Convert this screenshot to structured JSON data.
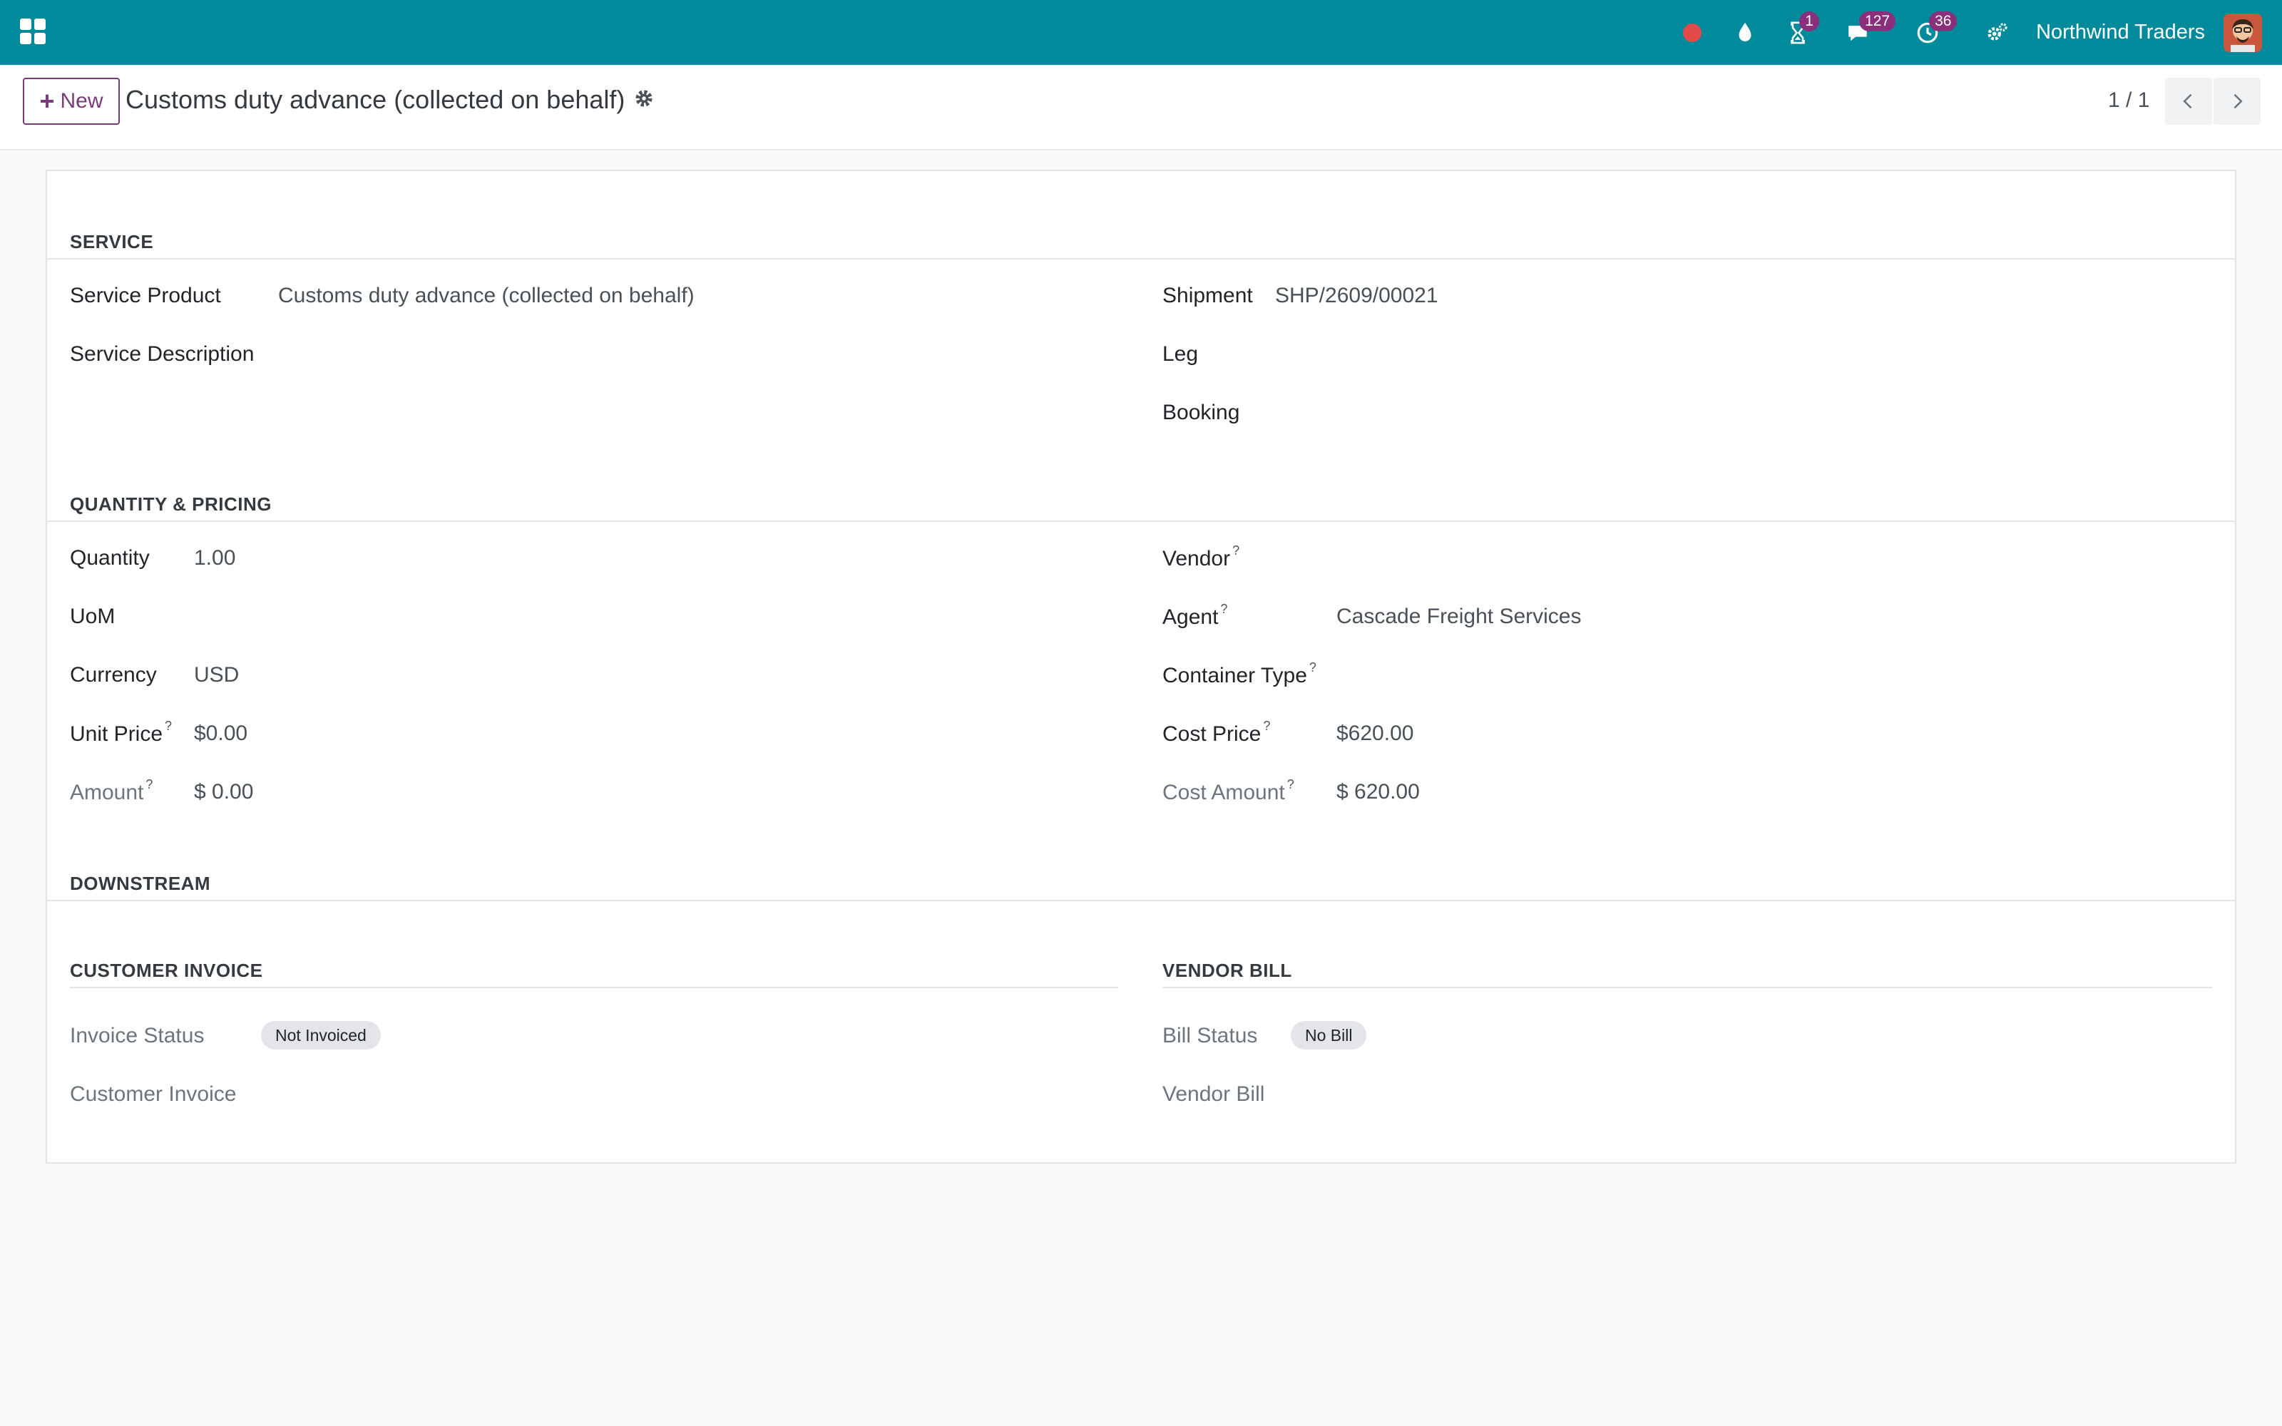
{
  "navbar": {
    "company": "Northwind Traders",
    "activity_count": "1",
    "messages_count": "127",
    "clock_count": "36",
    "accent": "#008a9c"
  },
  "control": {
    "new_label": "New",
    "title": "Customs duty advance (collected on behalf)",
    "pager": "1 / 1"
  },
  "service": {
    "section_title": "SERVICE",
    "product_label": "Service Product",
    "product_value": "Customs duty advance (collected on behalf)",
    "description_label": "Service Description",
    "shipment_label": "Shipment",
    "shipment_value": "SHP/2609/00021",
    "leg_label": "Leg",
    "booking_label": "Booking"
  },
  "pricing": {
    "section_title": "QUANTITY & PRICING",
    "quantity_label": "Quantity",
    "quantity_value": "1.00",
    "uom_label": "UoM",
    "currency_label": "Currency",
    "currency_value": "USD",
    "unit_price_label": "Unit Price",
    "unit_price_value": "$0.00",
    "amount_label": "Amount",
    "amount_value": "$ 0.00",
    "vendor_label": "Vendor",
    "agent_label": "Agent",
    "agent_value": "Cascade Freight Services",
    "container_label": "Container Type",
    "cost_price_label": "Cost Price",
    "cost_price_value": "$620.00",
    "cost_amount_label": "Cost Amount",
    "cost_amount_value": "$ 620.00",
    "help_mark": "?"
  },
  "downstream": {
    "section_title": "DOWNSTREAM",
    "customer_title": "CUSTOMER INVOICE",
    "invoice_status_label": "Invoice Status",
    "invoice_status_value": "Not Invoiced",
    "customer_invoice_label": "Customer Invoice",
    "vendor_title": "VENDOR BILL",
    "bill_status_label": "Bill Status",
    "bill_status_value": "No Bill",
    "vendor_bill_label": "Vendor Bill"
  }
}
